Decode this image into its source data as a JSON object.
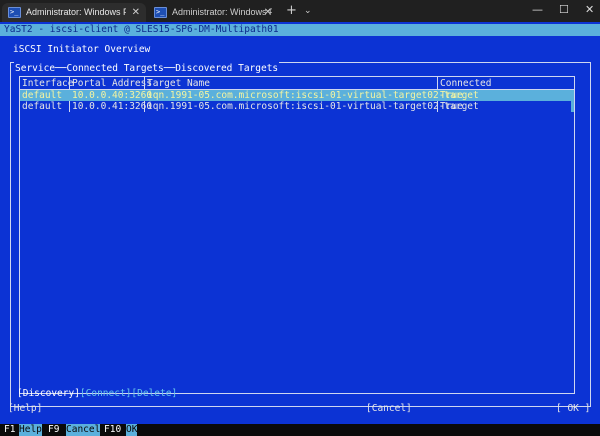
{
  "window": {
    "tabs": [
      {
        "label": "Administrator: Windows Powe",
        "icon": "terminal-icon",
        "active": true
      },
      {
        "label": "Administrator: Windows Powe",
        "icon": "terminal-icon",
        "active": false
      }
    ],
    "new_tab": "+",
    "tab_dropdown": "⌄",
    "controls": {
      "minimize": "—",
      "maximize": "☐",
      "close": "✕"
    }
  },
  "yast": {
    "header": "YaST2 - iscsi-client @ SLES15-SP6-DM-Multipath01",
    "overview_title": "iSCSI Initiator Overview",
    "tabs": {
      "service": "Service",
      "sep1": "──",
      "connected": "Connected Targets",
      "sep2": "──",
      "discovered": "Discovered Targets"
    },
    "table": {
      "columns": [
        "Interface",
        "Portal Address",
        "Target Name",
        "Connected"
      ],
      "rows": [
        [
          "default",
          "10.0.0.40:3260",
          "iqn.1991-05.com.microsoft:iscsi-01-virtual-target02-target",
          "True"
        ],
        [
          "default",
          "10.0.0.41:3260",
          "iqn.1991-05.com.microsoft:iscsi-01-virtual-target02-target",
          "True"
        ]
      ],
      "selected_row": 0
    },
    "buttons": {
      "discovery": "[Discovery]",
      "connect": "[Connect]",
      "delete": "[Delete]",
      "help": "[Help]",
      "cancel": "[Cancel]",
      "ok": "[ OK ]"
    },
    "fkeys": [
      {
        "key": "F1",
        "label": "Help"
      },
      {
        "key": "F9",
        "label": "Cancel"
      },
      {
        "key": "F10",
        "label": "OK"
      }
    ]
  },
  "colors": {
    "background": "#0c33d4",
    "highlight": "#5bb0dc",
    "selected_text": "#f4f4a0",
    "text": "#e6e6e6"
  }
}
